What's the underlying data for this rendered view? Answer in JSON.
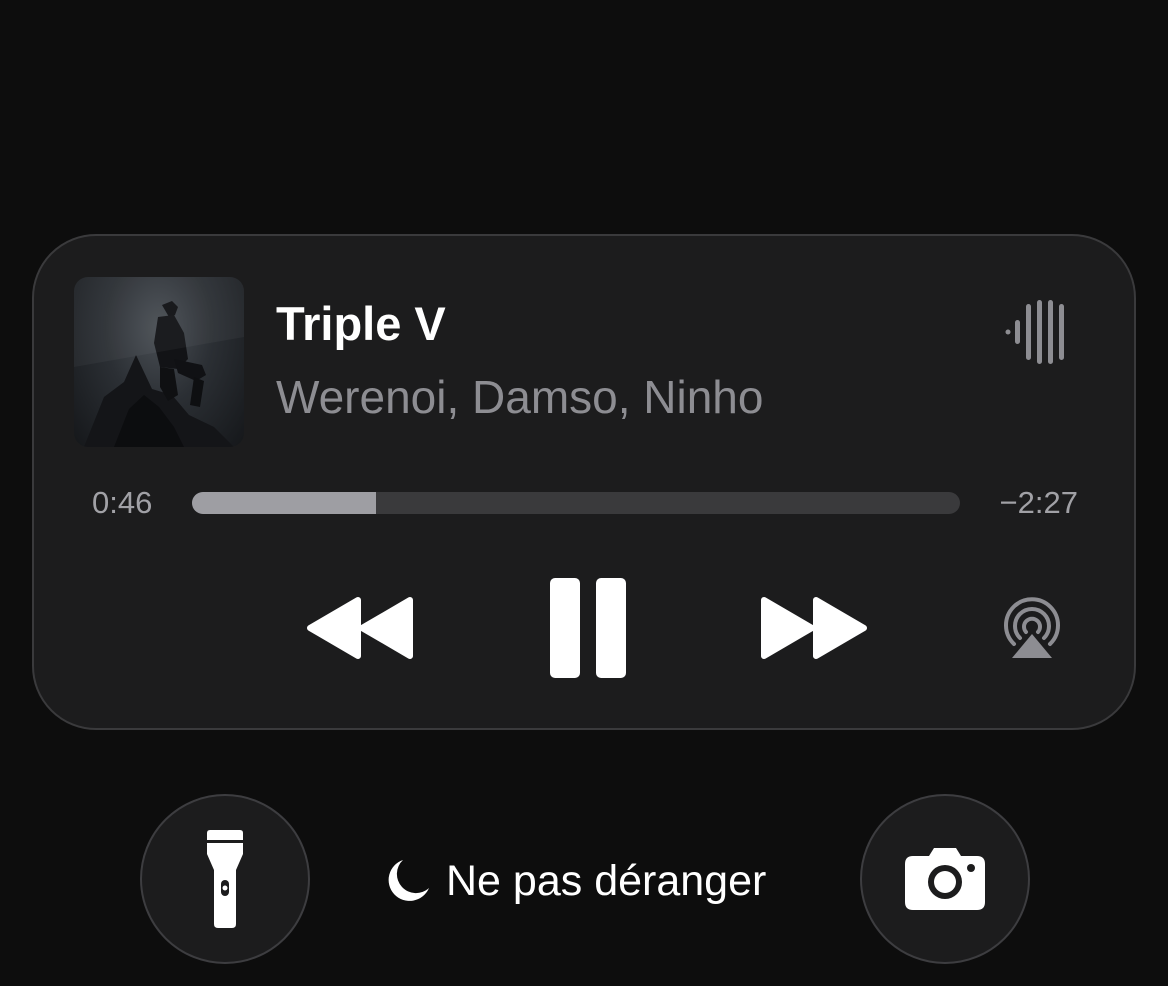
{
  "now_playing": {
    "title": "Triple V",
    "artist": "Werenoi, Damso, Ninho",
    "artwork_icon": "album-artwork",
    "visualizer_icon": "audio-waveform-icon",
    "progress": {
      "elapsed": "0:46",
      "remaining": "−2:27",
      "fraction": 0.24
    },
    "controls": {
      "rewind_icon": "rewind-icon",
      "pause_icon": "pause-icon",
      "forward_icon": "fast-forward-icon",
      "airplay_icon": "airplay-icon"
    }
  },
  "lock_screen": {
    "flashlight_icon": "flashlight-icon",
    "camera_icon": "camera-icon",
    "focus": {
      "icon": "moon-icon",
      "label": "Ne pas déranger"
    }
  },
  "colors": {
    "background": "#0d0d0d",
    "card": "#1c1c1d",
    "secondary_text": "#8d8d92",
    "progress_fill": "#9e9ea3",
    "progress_track": "#3a3a3c"
  }
}
